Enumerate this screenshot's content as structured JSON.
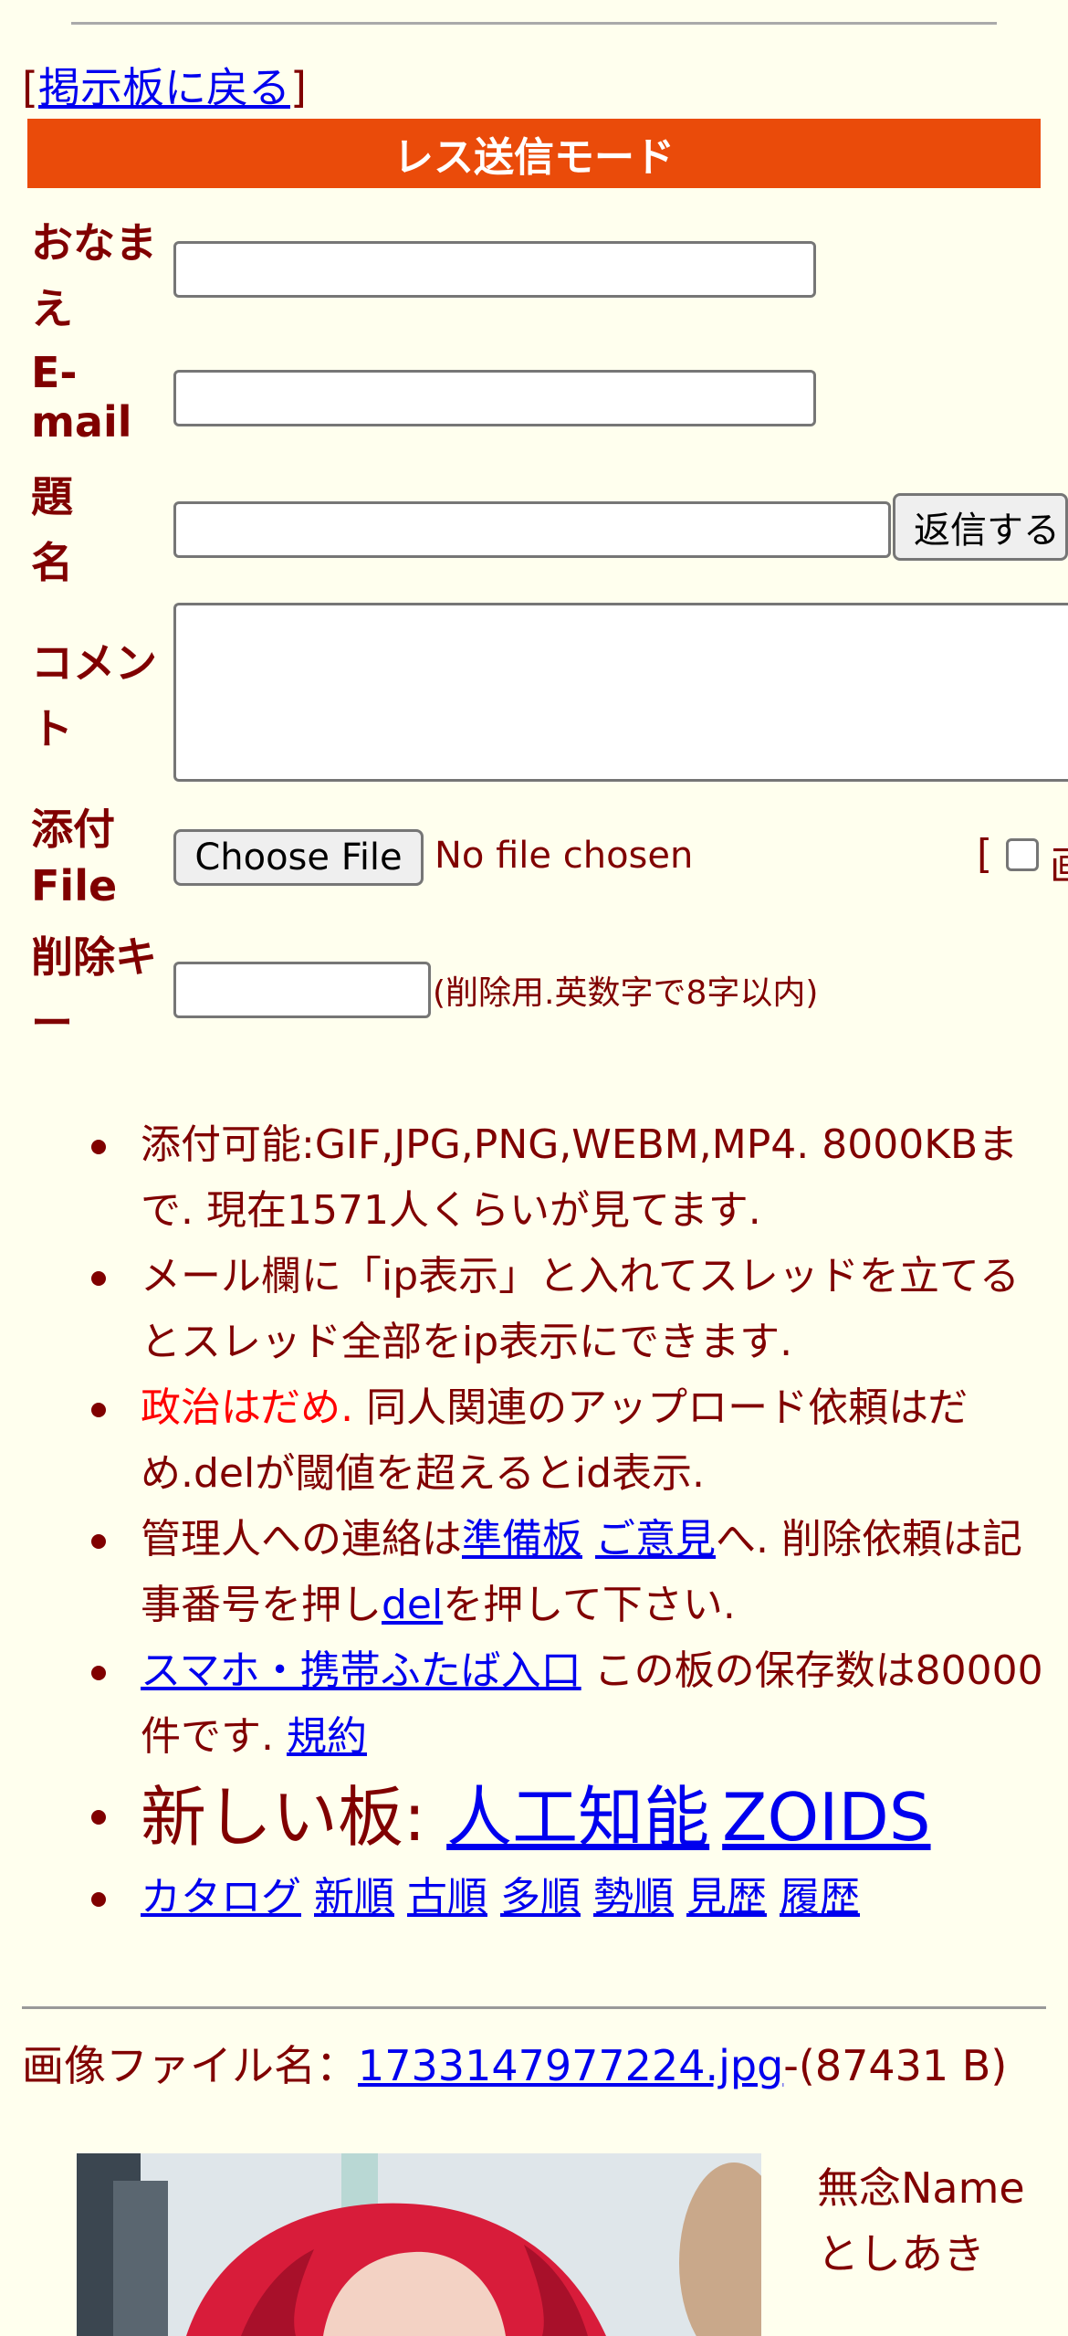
{
  "nav": {
    "back_bracket_open": "[",
    "back_link": "掲示板に戻る",
    "back_bracket_close": "]"
  },
  "form": {
    "mode_title": "レス送信モード",
    "name_label_1": "おなま",
    "name_label_2": "え",
    "email_label_1": "E-",
    "email_label_2": "mail",
    "subject_label_1": "題",
    "subject_label_2": "名",
    "submit_label": "返信する",
    "comment_label_1": "コメン",
    "comment_label_2": "ト",
    "file_label_1": "添付",
    "file_label_2": "File",
    "choose_file": "Choose File",
    "no_file": "No file chosen",
    "image_bracket": "[",
    "image_char": "画",
    "delkey_label_1": "削除キ",
    "delkey_label_2": "ー",
    "delkey_hint": "(削除用.英数字で8字以内)"
  },
  "info": {
    "item1": "添付可能:GIF,JPG,PNG,WEBM,MP4. 8000KBまで. 現在1571人くらいが見てます.",
    "item2": "メール欄に「ip表示」と入れてスレッドを立てるとスレッド全部をip表示にできます.",
    "item3_red": "政治はだめ.",
    "item3_rest": " 同人関連のアップロード依頼はだめ.delが閾値を超えるとid表示.",
    "item4_a": "管理人への連絡は",
    "item4_link1": "準備板",
    "item4_link2": "ご意見",
    "item4_b": "へ. 削除依頼は記事番号を押し",
    "item4_link3": "del",
    "item4_c": "を押して下さい.",
    "item5_link": "スマホ・携帯ふたば入口",
    "item5_text": " この板の保存数は80000件です. ",
    "item5_link2": "規約",
    "item6_text": "新しい板: ",
    "item6_link1": "人工知能",
    "item6_link2": "ZOIDS",
    "links": [
      "カタログ",
      "新順",
      "古順",
      "多順",
      "勢順",
      "見歴",
      "履歴"
    ]
  },
  "post": {
    "file_label": "画像ファイル名：",
    "file_link": "1733147977224.jpg",
    "file_size": "-(87431 B)",
    "poster_line1": "無念Name",
    "poster_line2": "としあき"
  }
}
